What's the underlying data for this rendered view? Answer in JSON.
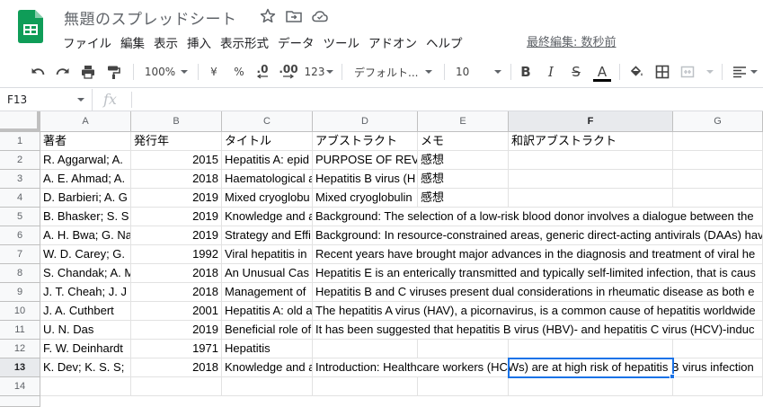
{
  "app": {
    "title": "無題のスプレッドシート",
    "last_edit": "最終編集: 数秒前"
  },
  "menu": [
    "ファイル",
    "編集",
    "表示",
    "挿入",
    "表示形式",
    "データ",
    "ツール",
    "アドオン",
    "ヘルプ"
  ],
  "toolbar": {
    "zoom": "100%",
    "currency": "¥",
    "percent": "%",
    "decrease_decimal": ".0",
    "increase_decimal": ".00",
    "number_format": "123",
    "font": "デフォルト...",
    "font_size": "10",
    "bold": "B",
    "italic": "I",
    "strikethrough": "S",
    "text_color_letter": "A",
    "text_color": "#000000"
  },
  "formula_bar": {
    "name_box": "F13",
    "fx": "fx",
    "content": ""
  },
  "columns": [
    "A",
    "B",
    "C",
    "D",
    "E",
    "F",
    "G"
  ],
  "selected_column": "F",
  "selected_row": "13",
  "rows": [
    {
      "n": "1",
      "A": "著者",
      "B": "発行年",
      "C": "タイトル",
      "D": "アブストラクト",
      "E": "メモ",
      "F": "和訳アブストラクト"
    },
    {
      "n": "2",
      "A": "R. Aggarwal; A.",
      "B": "2015",
      "C": "Hepatitis A: epid",
      "D": "PURPOSE OF REV",
      "E": "感想",
      "F": ""
    },
    {
      "n": "3",
      "A": "A. E. Ahmad; A.",
      "B": "2018",
      "C": "Haematological a",
      "D": "Hepatitis B virus (H",
      "E": "感想",
      "F": ""
    },
    {
      "n": "4",
      "A": "D. Barbieri; A. G",
      "B": "2019",
      "C": "Mixed cryoglobu",
      "D": "Mixed cryoglobulin",
      "E": "感想",
      "F": ""
    },
    {
      "n": "5",
      "A": "B. Bhasker; S. S",
      "B": "2019",
      "C": "Knowledge and a",
      "D": "Background: The selection of a low-risk blood donor involves a dialogue between the",
      "E": "",
      "F": ""
    },
    {
      "n": "6",
      "A": "A. H. Bwa; G. Na",
      "B": "2019",
      "C": "Strategy and Effi",
      "D": "Background: In resource-constrained areas, generic direct-acting antivirals (DAAs) hav",
      "E": "",
      "F": ""
    },
    {
      "n": "7",
      "A": "W. D. Carey; G.",
      "B": "1992",
      "C": "Viral hepatitis in",
      "D": "Recent years have brought major advances in the diagnosis and treatment of viral he",
      "E": "",
      "F": ""
    },
    {
      "n": "8",
      "A": "S. Chandak; A. M",
      "B": "2018",
      "C": "An Unusual Cas",
      "D": "Hepatitis E is an enterically transmitted and typically self-limited infection, that is caus",
      "E": "",
      "F": ""
    },
    {
      "n": "9",
      "A": "J. T. Cheah; J. J",
      "B": "2018",
      "C": "Management of",
      "D": "Hepatitis B and C viruses present dual considerations in rheumatic disease as both e",
      "E": "",
      "F": ""
    },
    {
      "n": "10",
      "A": "J. A. Cuthbert",
      "B": "2001",
      "C": "Hepatitis A: old a",
      "D": "The hepatitis A virus (HAV), a picornavirus, is a common cause of hepatitis worldwide",
      "E": "",
      "F": ""
    },
    {
      "n": "11",
      "A": "U. N. Das",
      "B": "2019",
      "C": "Beneficial role of",
      "D": "It has been suggested that hepatitis B virus (HBV)- and hepatitis C virus (HCV)-induc",
      "E": "",
      "F": ""
    },
    {
      "n": "12",
      "A": "F. W. Deinhardt",
      "B": "1971",
      "C": "Hepatitis",
      "D": "",
      "E": "",
      "F": ""
    },
    {
      "n": "13",
      "A": "K. Dev; K. S. S;",
      "B": "2018",
      "C": "Knowledge and a",
      "D": "Introduction: Healthcare workers (HCWs) are at high risk of hepatitis B virus infection",
      "E": "",
      "F": ""
    },
    {
      "n": "14",
      "A": "",
      "B": "",
      "C": "",
      "D": "",
      "E": "",
      "F": ""
    }
  ],
  "colors": {
    "brand_green": "#0f9d58",
    "selection": "#1a73e8",
    "header_bg": "#f8f9fa"
  }
}
